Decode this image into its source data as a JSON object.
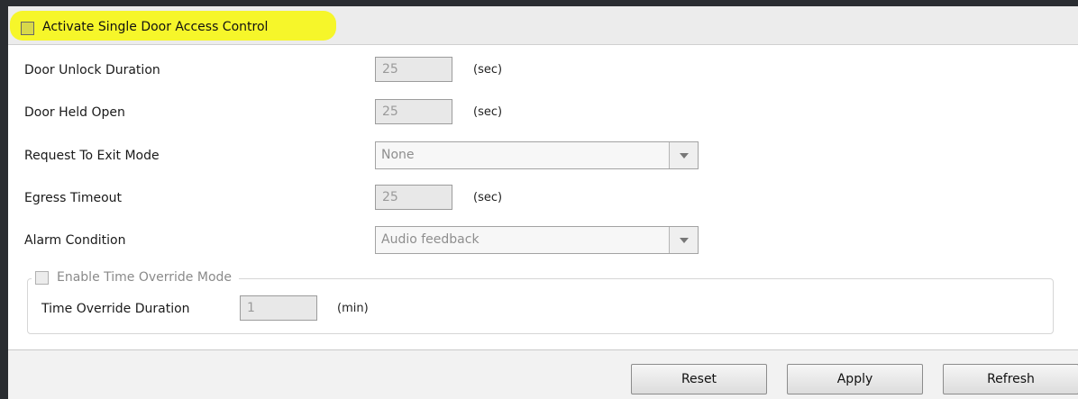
{
  "header": {
    "activate_label": "Activate Single Door Access Control",
    "highlight_color": "#f6f62a"
  },
  "fields": {
    "door_unlock_duration": {
      "label": "Door Unlock Duration",
      "value": "25",
      "unit": "(sec)"
    },
    "door_held_open": {
      "label": "Door Held Open",
      "value": "25",
      "unit": "(sec)"
    },
    "request_to_exit_mode": {
      "label": "Request To Exit Mode",
      "selected": "None"
    },
    "egress_timeout": {
      "label": "Egress Timeout",
      "value": "25",
      "unit": "(sec)"
    },
    "alarm_condition": {
      "label": "Alarm Condition",
      "selected": "Audio feedback"
    }
  },
  "time_override": {
    "enable_label": "Enable Time Override Mode",
    "duration_label": "Time Override Duration",
    "duration_value": "1",
    "duration_unit": "(min)"
  },
  "buttons": {
    "reset": "Reset",
    "apply": "Apply",
    "refresh": "Refresh"
  },
  "icons": {
    "dropdown": "chevron-down-icon"
  }
}
